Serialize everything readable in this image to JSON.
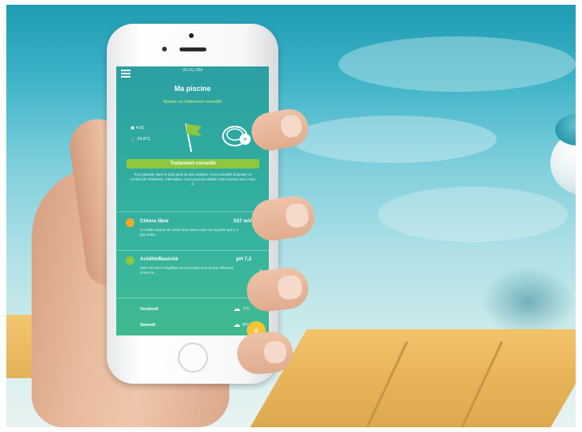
{
  "app": {
    "title": "Ma piscine",
    "subtitle": "Ajouter un traitement conseillé",
    "status_time": "00:41 AM",
    "stats": [
      {
        "icon": "calendar-icon",
        "value": "4.61"
      },
      {
        "icon": "anchor-icon",
        "value": "24.8°C"
      }
    ],
    "cta_label": "Traitement conseillé",
    "cta_description": "Pour garantir dans le bain peut on des analyse. Il est conseillé d'ajouter un produit de traitement. Alternative, nous pouvons utiliser votre piscine avec l'eau à."
  },
  "metrics": [
    {
      "name": "Chlore libre",
      "value": "537 mV",
      "dot_color": "#f5a623",
      "description": "Un faible niveau de chlore libre dans votre eau signifie qu'il y a peu traite..."
    },
    {
      "name": "Acidité/Basicité",
      "value": "pH 7,2",
      "dot_color": "#8dc63f",
      "description": "Votre pH est à l'équilibre et est propice à la bonne efficacité d'une tra..."
    }
  ],
  "forecast": [
    {
      "day": "Vendredi",
      "weather_icon": "cloud-icon",
      "temp": "7°C"
    },
    {
      "day": "Samedi",
      "weather_icon": "cloud-icon",
      "temp": "8°C"
    }
  ],
  "colors": {
    "screen_teal": "#2eaa9f",
    "accent_green": "#8dc63f",
    "warning_orange": "#f5a623",
    "fab_yellow": "#f6c437"
  }
}
